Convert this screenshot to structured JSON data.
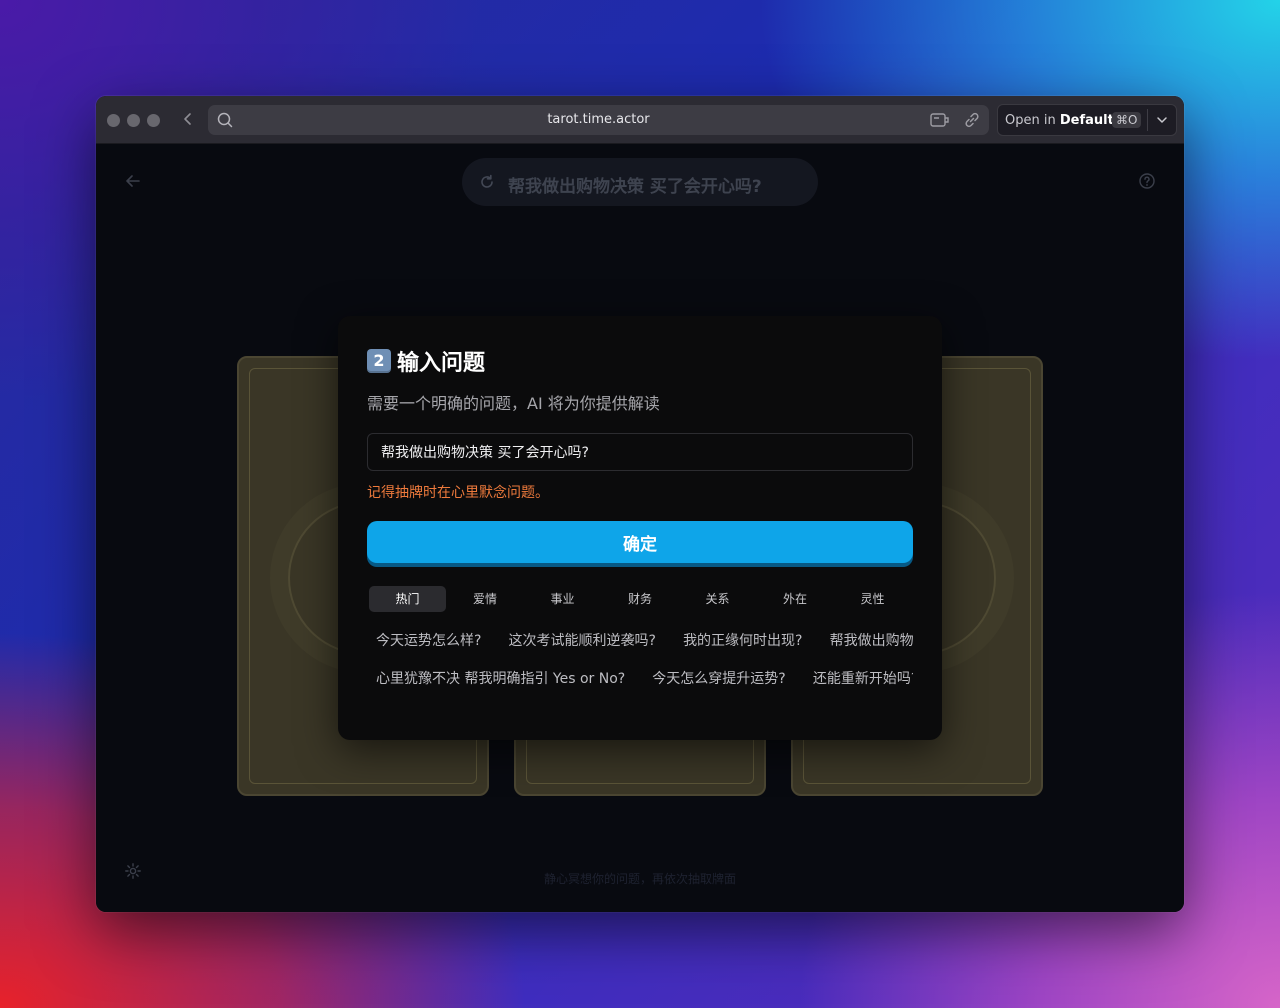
{
  "browser": {
    "url": "tarot.time.actor",
    "open_in_prefix": "Open in",
    "open_in_target": "Default",
    "open_in_shortcut": "⌘O"
  },
  "page": {
    "current_question": "帮我做出购物决策 买了会开心吗?",
    "footer_hint": "静心冥想你的问题，再依次抽取牌面"
  },
  "modal": {
    "step_number": "2",
    "title": "输入问题",
    "subtitle": "需要一个明确的问题，AI 将为你提供解读",
    "input_value": "帮我做出购物决策 买了会开心吗?",
    "hint": "记得抽牌时在心里默念问题。",
    "confirm_label": "确定",
    "tabs": [
      "热门",
      "爱情",
      "事业",
      "财务",
      "关系",
      "外在",
      "灵性"
    ],
    "active_tab": "热门",
    "suggestions_row1": [
      "今天运势怎么样?",
      "这次考试能顺利逆袭吗?",
      "我的正缘何时出现?",
      "帮我做出购物决策 买了会开心吗?"
    ],
    "suggestions_row2": [
      "心里犹豫不决 帮我明确指引 Yes or No?",
      "今天怎么穿提升运势?",
      "还能重新开始吗?"
    ]
  },
  "icons": {
    "back": "chevron-left-icon",
    "search": "search-icon",
    "extension": "extension-icon",
    "link": "link-icon",
    "dropdown": "chevron-down-icon",
    "page_back": "arrow-left-icon",
    "refresh": "refresh-icon",
    "help": "help-circle-icon",
    "settings": "gear-icon"
  },
  "colors": {
    "accent": "#0ea5e9",
    "hint": "#ee7a3c",
    "step_badge": "#6f8fb5"
  }
}
